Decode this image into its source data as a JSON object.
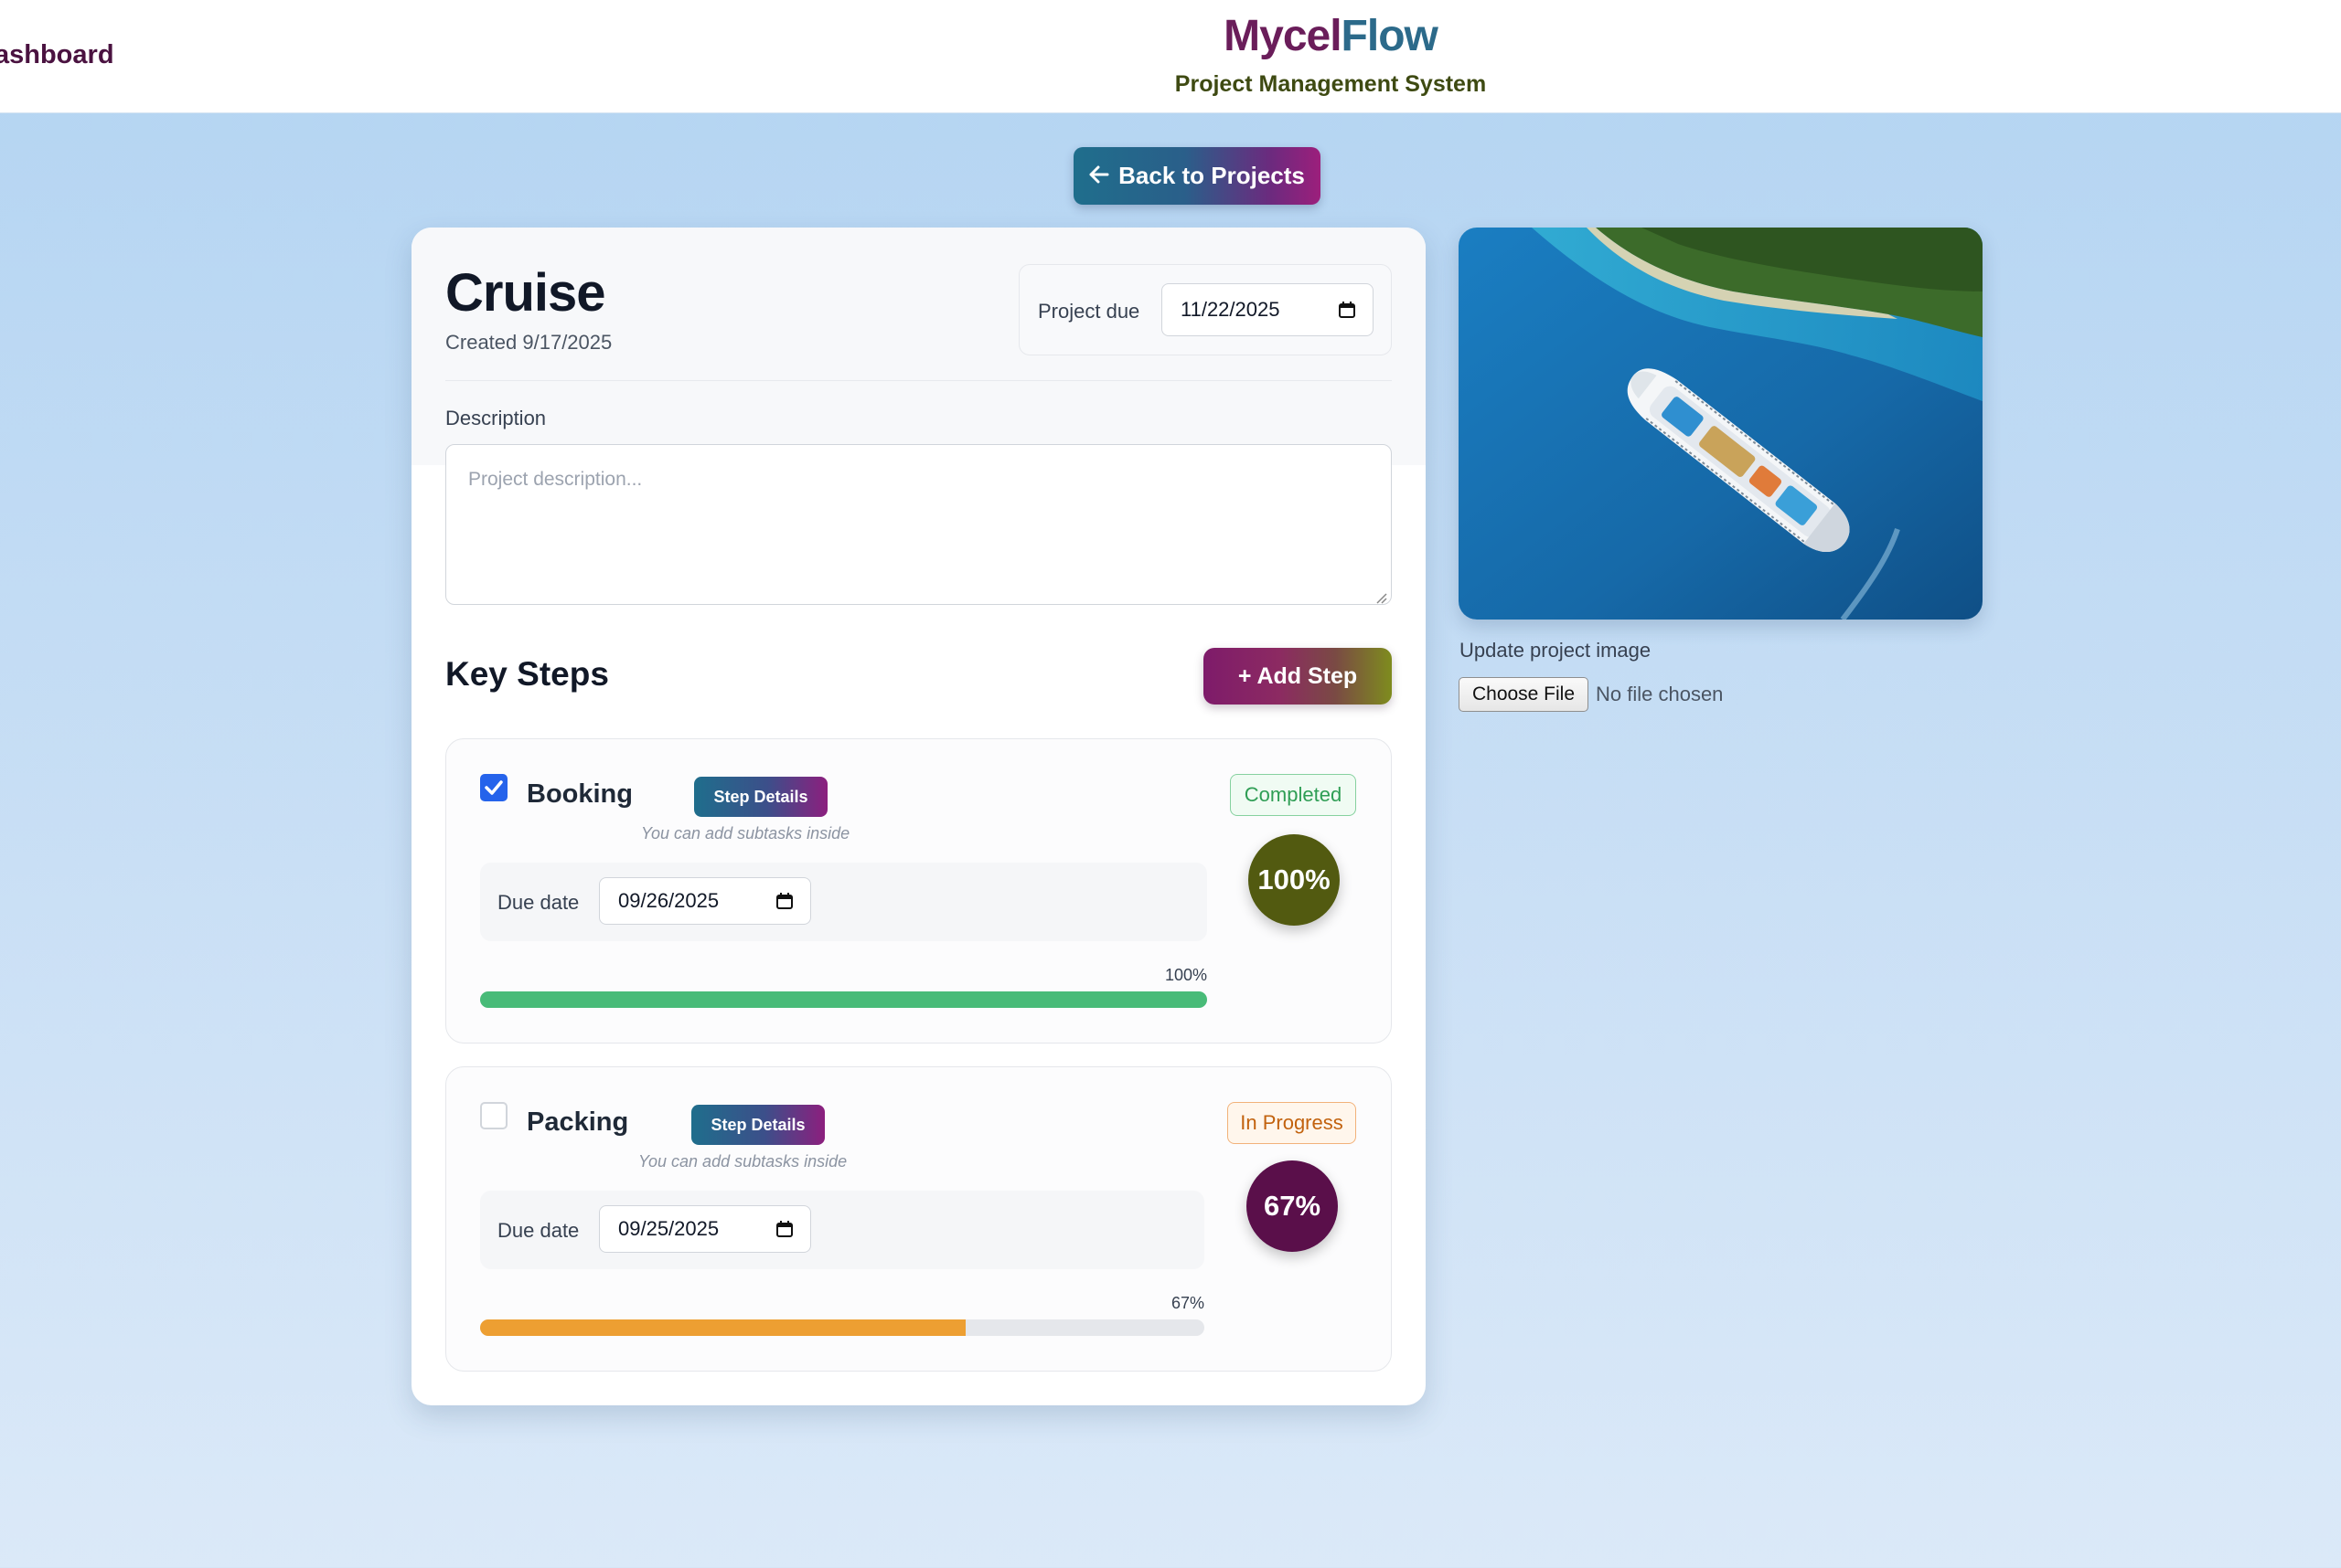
{
  "header": {
    "nav_dashboard": "ashboard",
    "brand_part1": "Mycel",
    "brand_part2": "Flow",
    "tagline": "Project Management System"
  },
  "back_button": {
    "label": "Back to Projects",
    "icon": "arrow-left-icon"
  },
  "project": {
    "title": "Cruise",
    "created": "Created 9/17/2025",
    "due_label": "Project due",
    "due_date": "11/22/2025",
    "description_label": "Description",
    "description_value": "",
    "description_placeholder": "Project description..."
  },
  "key_steps": {
    "title": "Key Steps",
    "add_step_label": "+ Add Step",
    "steps": [
      {
        "name": "Booking",
        "checked": true,
        "details_label": "Step Details",
        "hint": "You can add subtasks inside",
        "status": "Completed",
        "percent_label": "100%",
        "due_label": "Due date",
        "due_date": "09/26/2025",
        "progress_label": "100%",
        "progress": 1.0,
        "bar_color": "#48bb78",
        "circle_color": "#525a10"
      },
      {
        "name": "Packing",
        "checked": false,
        "details_label": "Step Details",
        "hint": "You can add subtasks inside",
        "status": "In Progress",
        "percent_label": "67%",
        "due_label": "Due date",
        "due_date": "09/25/2025",
        "progress_label": "67%",
        "progress": 0.67,
        "bar_color": "#ed9f32",
        "circle_color": "#5a0f4a"
      }
    ]
  },
  "image_panel": {
    "update_label": "Update project image",
    "choose_file_label": "Choose File",
    "no_file_text": "No file chosen"
  },
  "colors": {
    "accent_teal": "#1f6e8c",
    "accent_purple": "#8c1f7e",
    "completed_green": "#2f9e55",
    "in_progress_orange": "#c2620e"
  }
}
